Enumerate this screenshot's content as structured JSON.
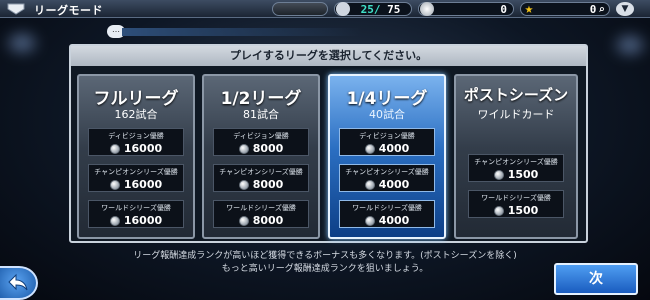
{
  "topbar": {
    "title": "リーグモード",
    "dark_pill_text": "",
    "players_current": "25",
    "players_separator": "/",
    "players_max": "75",
    "coins": "0",
    "stars": "0"
  },
  "panel": {
    "header": "プレイするリーグを選択してください。"
  },
  "leagues": [
    {
      "name": "フルリーグ",
      "sub": "162試合",
      "selected": false,
      "rewards": [
        {
          "label": "ディビジョン優勝",
          "amount": "16000"
        },
        {
          "label": "チャンピオンシリーズ優勝",
          "amount": "16000"
        },
        {
          "label": "ワールドシリーズ優勝",
          "amount": "16000"
        }
      ]
    },
    {
      "name": "1/2リーグ",
      "sub": "81試合",
      "selected": false,
      "rewards": [
        {
          "label": "ディビジョン優勝",
          "amount": "8000"
        },
        {
          "label": "チャンピオンシリーズ優勝",
          "amount": "8000"
        },
        {
          "label": "ワールドシリーズ優勝",
          "amount": "8000"
        }
      ]
    },
    {
      "name": "1/4リーグ",
      "sub": "40試合",
      "selected": true,
      "rewards": [
        {
          "label": "ディビジョン優勝",
          "amount": "4000"
        },
        {
          "label": "チャンピオンシリーズ優勝",
          "amount": "4000"
        },
        {
          "label": "ワールドシリーズ優勝",
          "amount": "4000"
        }
      ]
    },
    {
      "name": "ポストシーズン",
      "sub": "ワイルドカード",
      "selected": false,
      "rewards": [
        {
          "label": "チャンピオンシリーズ優勝",
          "amount": "1500"
        },
        {
          "label": "ワールドシリーズ優勝",
          "amount": "1500"
        }
      ]
    }
  ],
  "footer": {
    "line1": "リーグ報酬達成ランクが高いほど獲得できるボーナスも多くなります。(ポストシーズンを除く)",
    "line2": "もっと高いリーグ報酬達成ランクを狙いましょう。"
  },
  "buttons": {
    "next": "次"
  },
  "icons": {
    "home": "home-plate-icon",
    "players": "cap-icon",
    "coins": "coin-icon",
    "stars": "star-icon",
    "zoom": "search-icon",
    "menu": "chevron-down-icon",
    "chat": "chat-icon",
    "back": "back-arrow-icon",
    "reward": "coin-icon"
  },
  "colors": {
    "selected_card": "#2b6fc2",
    "card": "#333d4a",
    "star": "#f5c518"
  }
}
